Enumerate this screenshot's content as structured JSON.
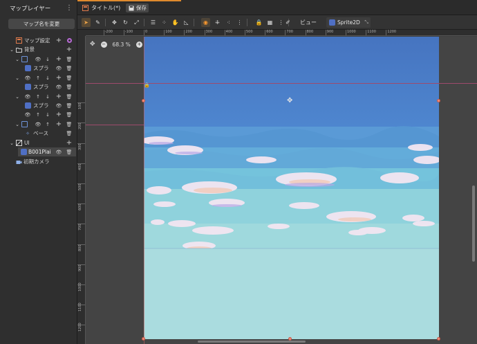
{
  "left_panel": {
    "title": "マップレイヤー",
    "menu_glyph": "⋮",
    "rename_button": "マップ名を変更",
    "tree": {
      "map_settings": "マップ設定",
      "background": "背景",
      "sprite_a": "スプラ",
      "sprite_b": "スプラ",
      "sprite_c": "スプラ",
      "base": "ベース",
      "ui": "UI",
      "b001": "B001Plai",
      "initial_camera": "初期カメラ"
    }
  },
  "top_bar": {
    "tab_title": "タイトル(*)",
    "save_label": "保存"
  },
  "toolbar": {
    "view_label": "ビュー",
    "node_label": "Sprite2D"
  },
  "viewport": {
    "zoom_level": "68.3 %"
  },
  "ruler_top": [
    "-200",
    "-100",
    "0",
    "100",
    "200",
    "300",
    "400",
    "500",
    "600",
    "700",
    "800",
    "900",
    "1000",
    "1100",
    "1200"
  ],
  "ruler_left": [
    "100",
    "200",
    "300",
    "400",
    "500",
    "600",
    "700",
    "800",
    "900",
    "1000",
    "1100",
    "1200"
  ],
  "colors": {
    "accent": "#e08a2d",
    "sky_top": "#4a7cc7",
    "sky_bottom": "#a9dde0",
    "guide_red": "#9e4a6c"
  }
}
